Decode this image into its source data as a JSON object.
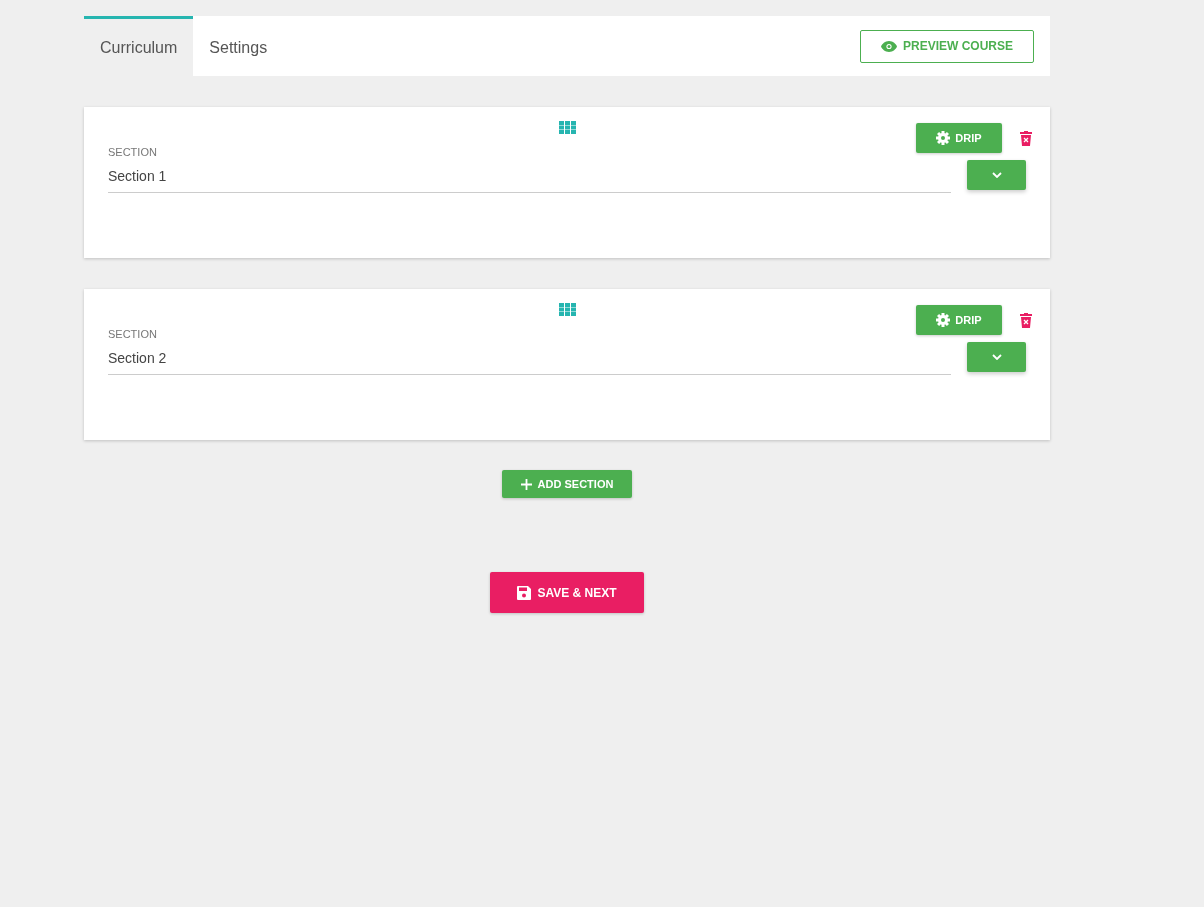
{
  "tabs": [
    {
      "label": "Curriculum",
      "selected": true
    },
    {
      "label": "Settings",
      "selected": false
    }
  ],
  "preview_button": "PREVIEW COURSE",
  "sections": [
    {
      "label": "SECTION",
      "value": "Section 1",
      "drip_button": "DRIP"
    },
    {
      "label": "SECTION",
      "value": "Section 2",
      "drip_button": "DRIP"
    }
  ],
  "add_section_button": "ADD SECTION",
  "save_button": "SAVE & NEXT"
}
